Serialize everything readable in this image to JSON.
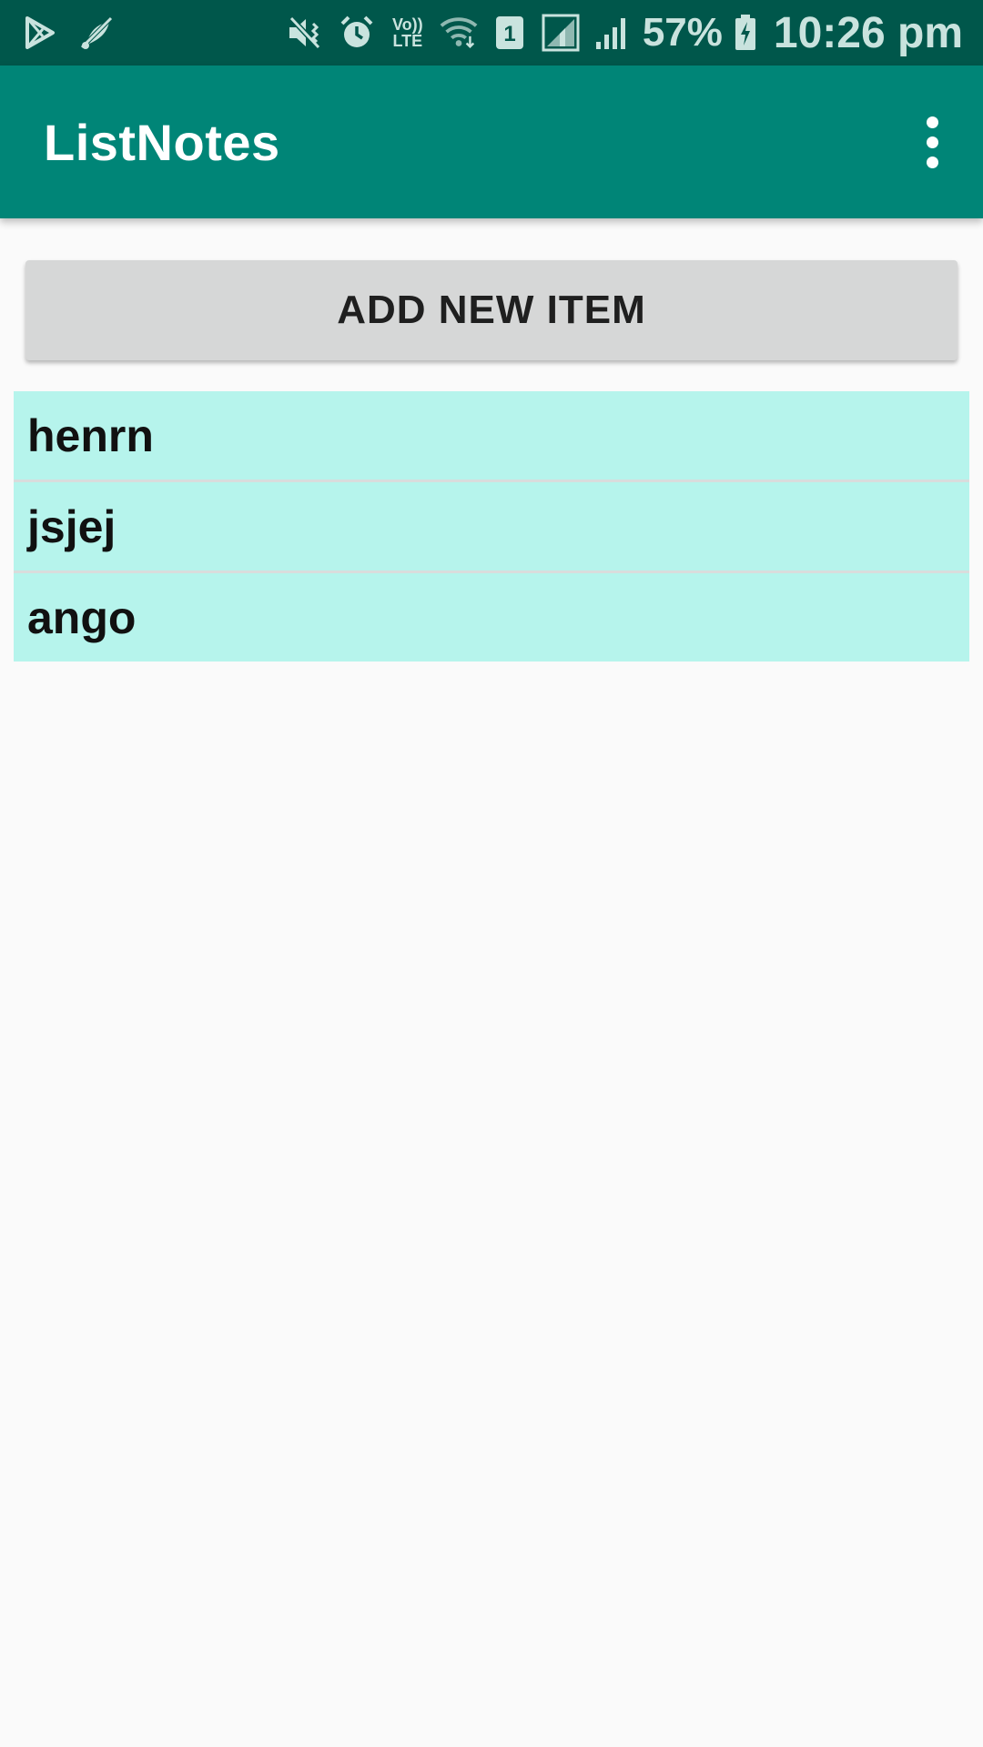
{
  "status_bar": {
    "battery_percent": "57%",
    "time": "10:26 pm",
    "volte_top": "Vo))",
    "volte_bottom": "LTE",
    "sim_slot": "1",
    "icons": [
      "play-store-icon",
      "satellite-off-icon",
      "vibrate-mute-icon",
      "alarm-icon",
      "volte-icon",
      "wifi-icon",
      "sim-1-icon",
      "signal-icon",
      "signal-weak-icon",
      "battery-charging-icon"
    ]
  },
  "app_bar": {
    "title": "ListNotes",
    "overflow_icon": "more-vert-icon"
  },
  "main": {
    "add_button_label": "ADD NEW ITEM",
    "notes": [
      "henrn",
      "jsjej",
      "ango"
    ]
  },
  "colors": {
    "status_bar": "#00574b",
    "app_bar": "#008577",
    "list_item_bg": "#b6f4ec",
    "button_bg": "#d6d7d7",
    "background": "#fafafa"
  }
}
